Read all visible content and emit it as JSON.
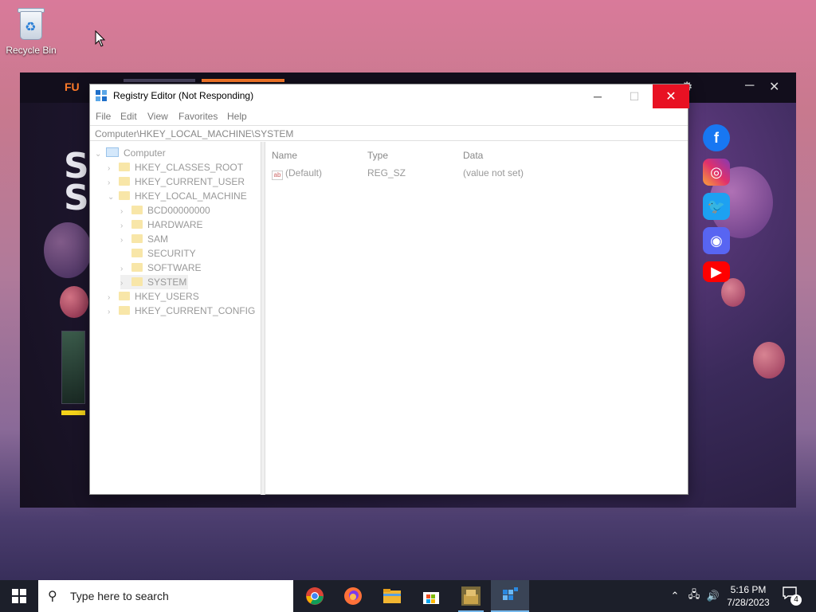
{
  "desktop": {
    "recycle_bin_label": "Recycle Bin"
  },
  "launcher": {
    "brand": "FU",
    "hero_text": "S\nSU"
  },
  "regedit": {
    "title": "Registry Editor (Not Responding)",
    "menu": [
      "File",
      "Edit",
      "View",
      "Favorites",
      "Help"
    ],
    "address": "Computer\\HKEY_LOCAL_MACHINE\\SYSTEM",
    "tree": {
      "root": "Computer",
      "hives": [
        "HKEY_CLASSES_ROOT",
        "HKEY_CURRENT_USER",
        "HKEY_LOCAL_MACHINE"
      ],
      "hklm_children": [
        "BCD00000000",
        "HARDWARE",
        "SAM",
        "SECURITY",
        "SOFTWARE",
        "SYSTEM"
      ],
      "hives_after": [
        "HKEY_USERS",
        "HKEY_CURRENT_CONFIG"
      ],
      "selected": "SYSTEM"
    },
    "columns": {
      "name": "Name",
      "type": "Type",
      "data": "Data"
    },
    "values": [
      {
        "name": "(Default)",
        "type": "REG_SZ",
        "data": "(value not set)"
      }
    ]
  },
  "taskbar": {
    "search_placeholder": "Type here to search",
    "apps": [
      "chrome-icon",
      "firefox-icon",
      "file-explorer-icon",
      "microsoft-store-icon",
      "game-icon",
      "registry-editor-icon"
    ],
    "time": "5:16 PM",
    "date": "7/28/2023",
    "notification_count": "4"
  },
  "colors": {
    "close_button": "#e81123",
    "accent": "#ff7b2a",
    "taskbar": "#1c1f2a"
  }
}
